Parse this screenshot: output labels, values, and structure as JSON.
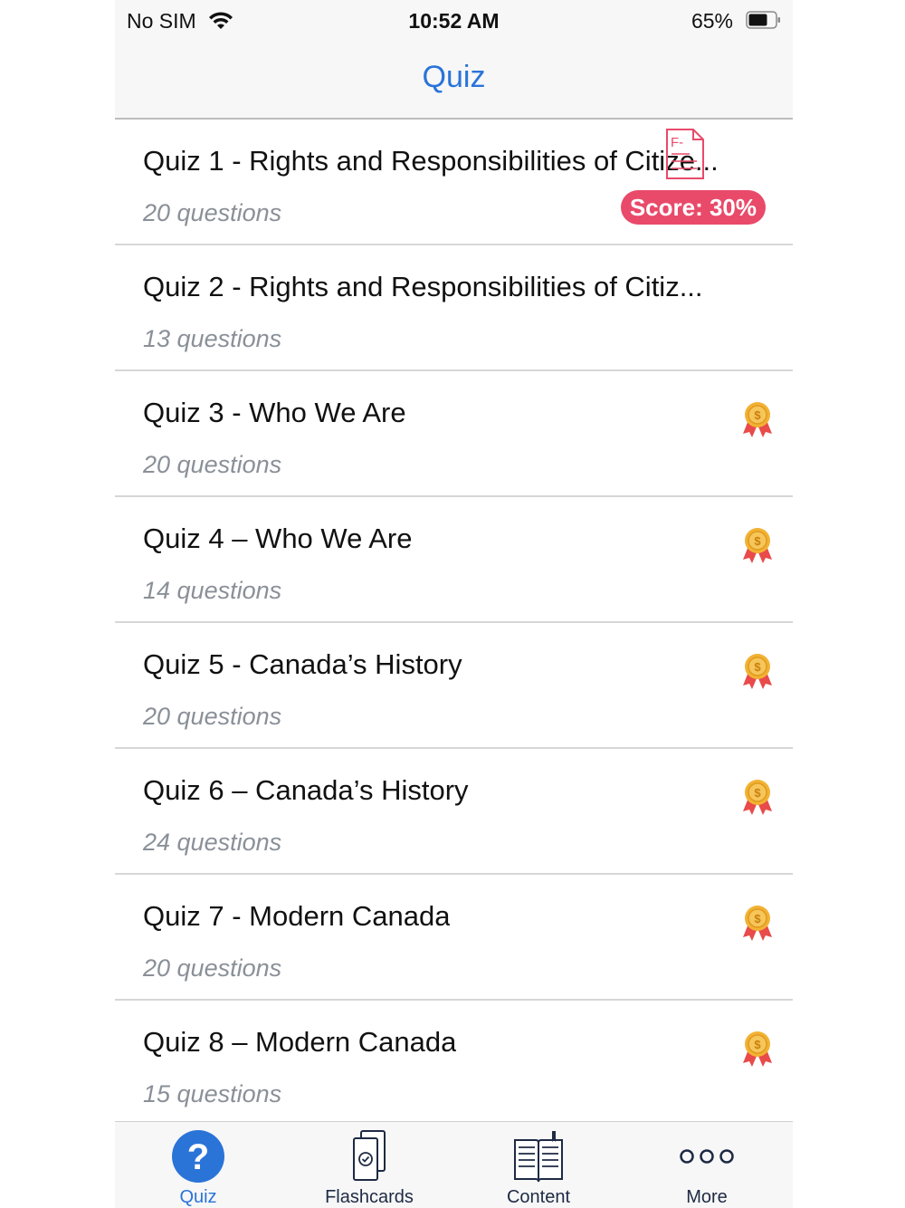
{
  "status_bar": {
    "carrier": "No SIM",
    "time": "10:52 AM",
    "battery": "65%"
  },
  "nav": {
    "title": "Quiz"
  },
  "quizzes": [
    {
      "title": "Quiz 1 - Rights and Responsibilities of Citize...",
      "count": "20 questions",
      "score": "Score: 30%",
      "grade_icon": "f-grade-icon",
      "grade_text": "F-"
    },
    {
      "title": "Quiz 2 - Rights and Responsibilities of Citiz...",
      "count": "13 questions"
    },
    {
      "title": "Quiz 3 - Who We Are",
      "count": "20 questions",
      "badge": "medal-icon"
    },
    {
      "title": "Quiz 4 – Who We Are",
      "count": "14 questions",
      "badge": "medal-icon"
    },
    {
      "title": "Quiz 5 - Canada’s History",
      "count": "20 questions",
      "badge": "medal-icon"
    },
    {
      "title": "Quiz 6 – Canada’s History",
      "count": "24 questions",
      "badge": "medal-icon"
    },
    {
      "title": "Quiz 7 - Modern Canada",
      "count": "20 questions",
      "badge": "medal-icon"
    },
    {
      "title": "Quiz 8 – Modern Canada",
      "count": "15 questions",
      "badge": "medal-icon"
    }
  ],
  "tabs": [
    {
      "label": "Quiz",
      "icon": "question-icon",
      "active": true
    },
    {
      "label": "Flashcards",
      "icon": "flashcards-icon"
    },
    {
      "label": "Content",
      "icon": "book-icon"
    },
    {
      "label": "More",
      "icon": "more-icon"
    }
  ],
  "colors": {
    "accent": "#2a74d8",
    "score_badge": "#e94a6a",
    "medal_gold": "#f2b233",
    "medal_ribbon": "#e94a4a"
  }
}
